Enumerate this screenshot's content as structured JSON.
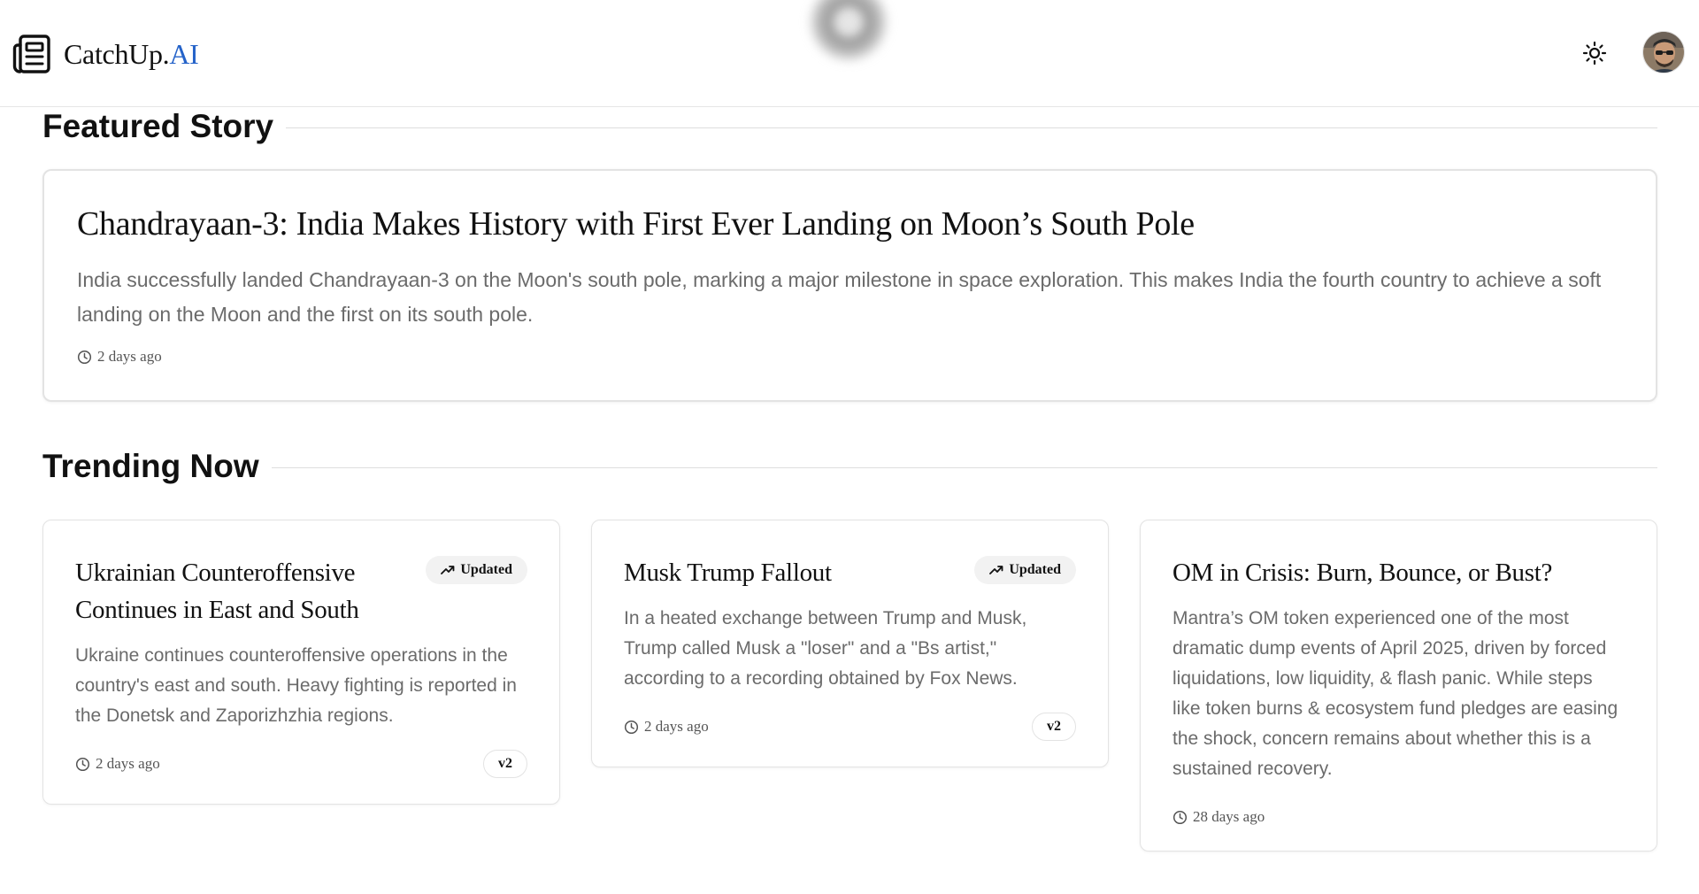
{
  "header": {
    "brand_prefix": "CatchUp.",
    "brand_suffix": "AI",
    "brand_accent_color": "#2563c9",
    "icons": {
      "logo": "newspaper-icon",
      "theme": "sun-icon",
      "avatar": "user-avatar"
    }
  },
  "featured": {
    "heading": "Featured Story",
    "title": "Chandrayaan-3: India Makes History with First Ever Landing on Moon’s South Pole",
    "summary": "India successfully landed Chandrayaan-3 on the Moon's south pole, marking a major milestone in space exploration. This makes India the fourth country to achieve a soft landing on the Moon and the first on its south pole.",
    "time": "2 days ago"
  },
  "trending": {
    "heading": "Trending Now",
    "cards": [
      {
        "title": "Ukrainian Counteroffensive Continues in East and South",
        "badge": "Updated",
        "summary": "Ukraine continues counteroffensive operations in the country's east and south. Heavy fighting is reported in the Donetsk and Zaporizhzhia regions.",
        "time": "2 days ago",
        "version": "v2"
      },
      {
        "title": "Musk Trump Fallout",
        "badge": "Updated",
        "summary": "In a heated exchange between Trump and Musk, Trump called Musk a \"loser\" and a \"Bs artist,\" according to a recording obtained by Fox News.",
        "time": "2 days ago",
        "version": "v2"
      },
      {
        "title": "OM in Crisis: Burn, Bounce, or Bust?",
        "summary": "Mantra’s OM token experienced one of the most dramatic dump events of April 2025, driven by forced liquidations, low liquidity, & flash panic. While steps like token burns & ecosystem fund pledges are easing the shock, concern remains about whether this is a sustained recovery.",
        "time": "28 days ago"
      }
    ]
  }
}
